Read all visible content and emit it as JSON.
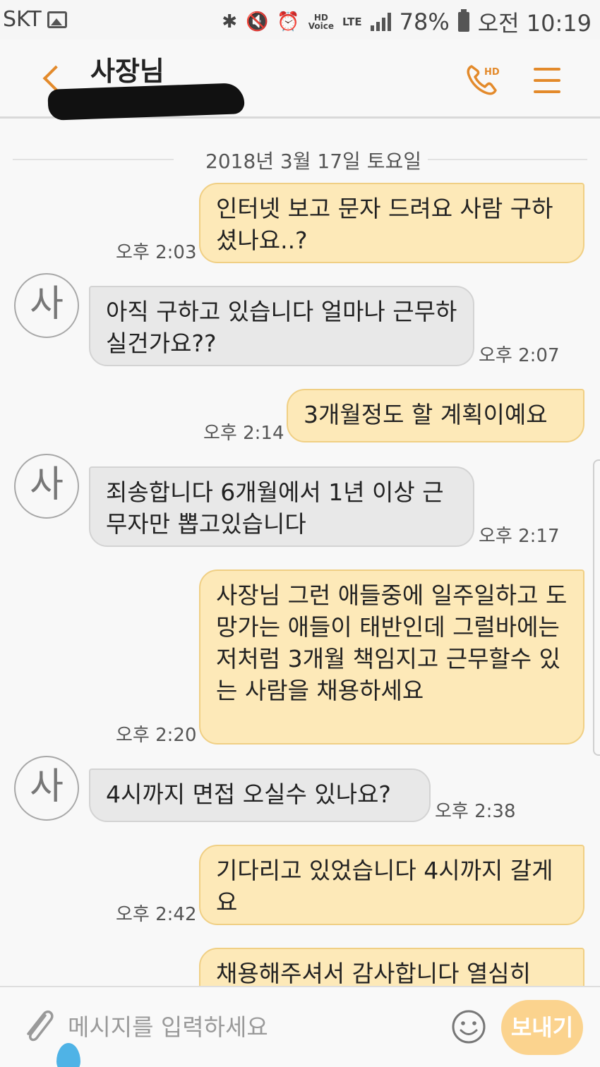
{
  "status_bar": {
    "carrier": "SKT",
    "battery": "78%",
    "time": "오전 10:19",
    "hd_top": "HD",
    "hd_bottom": "Voice",
    "network": "LTE"
  },
  "header": {
    "title": "사장님",
    "call_badge": "HD",
    "accent_color": "#e38a2b"
  },
  "chat": {
    "date": "2018년 3월 17일 토요일",
    "avatar_initial": "사",
    "messages": [
      {
        "direction": "out",
        "text": "인터넷 보고 문자 드려요 사람 구하셨나요..?",
        "time": "오후 2:03"
      },
      {
        "direction": "in",
        "text": "아직 구하고 있습니다 얼마나 근무하실건가요??",
        "time": "오후 2:07"
      },
      {
        "direction": "out",
        "text": "3개월정도 할 계획이예요",
        "time": "오후 2:14"
      },
      {
        "direction": "in",
        "text": "죄송합니다 6개월에서 1년 이상 근무자만 뽑고있습니다",
        "time": "오후 2:17"
      },
      {
        "direction": "out",
        "text": "사장님 그런 애들중에 일주일하고 도망가는 애들이 태반인데 그럴바에는 저처럼 3개월 책임지고 근무할수 있는 사람을 채용하세요",
        "time": "오후 2:20"
      },
      {
        "direction": "in",
        "text": "4시까지 면접 오실수 있나요?",
        "time": "오후 2:38"
      },
      {
        "direction": "out",
        "text": "기다리고 있었습니다 4시까지 갈게요",
        "time": "오후 2:42"
      },
      {
        "direction": "out",
        "text": "채용해주셔서 감사합니다 열심히",
        "time": ""
      }
    ]
  },
  "input": {
    "placeholder": "메시지를 입력하세요",
    "send_label": "보내기"
  }
}
